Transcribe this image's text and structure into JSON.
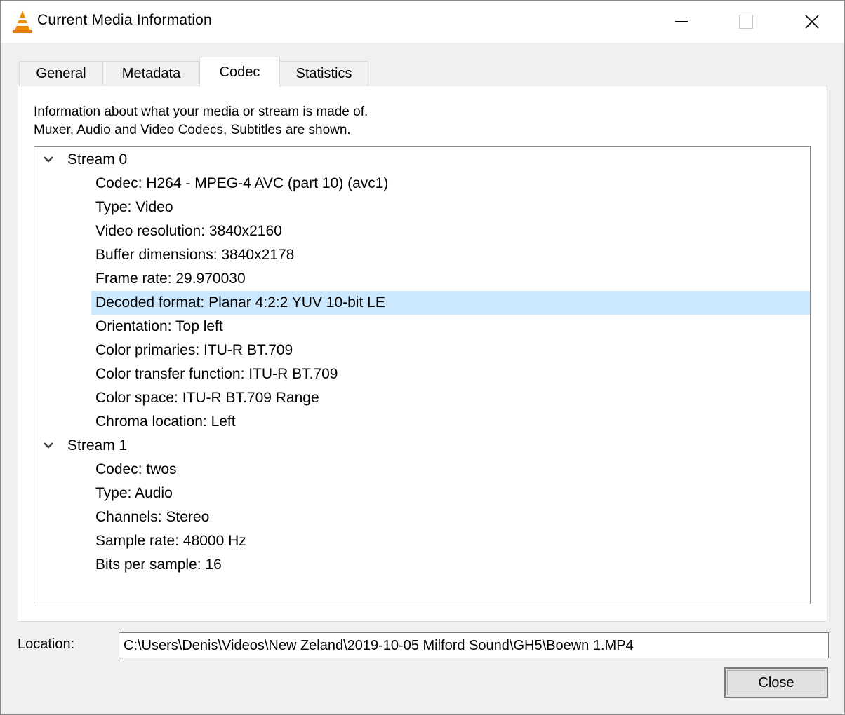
{
  "window": {
    "title": "Current Media Information",
    "app_icon": "vlc-cone-icon"
  },
  "tabs": [
    {
      "label": "General"
    },
    {
      "label": "Metadata"
    },
    {
      "label": "Codec",
      "active": true
    },
    {
      "label": "Statistics"
    }
  ],
  "codec_panel": {
    "description_line1": "Information about what your media or stream is made of.",
    "description_line2": "Muxer, Audio and Video Codecs, Subtitles are shown.",
    "streams": [
      {
        "label": "Stream 0",
        "expanded": true,
        "properties": [
          "Codec: H264 - MPEG-4 AVC (part 10) (avc1)",
          "Type: Video",
          "Video resolution: 3840x2160",
          "Buffer dimensions: 3840x2178",
          "Frame rate: 29.970030",
          "Decoded format: Planar 4:2:2 YUV 10-bit LE",
          "Orientation: Top left",
          "Color primaries: ITU-R BT.709",
          "Color transfer function: ITU-R BT.709",
          "Color space: ITU-R BT.709 Range",
          "Chroma location: Left"
        ],
        "selected_property": "Decoded format: Planar 4:2:2 YUV 10-bit LE"
      },
      {
        "label": "Stream 1",
        "expanded": true,
        "properties": [
          "Codec: twos",
          "Type: Audio",
          "Channels: Stereo",
          "Sample rate: 48000 Hz",
          "Bits per sample: 16"
        ]
      }
    ]
  },
  "location": {
    "label": "Location:",
    "value": "C:\\Users\\Denis\\Videos\\New Zeland\\2019-10-05 Milford Sound\\GH5\\Boewn 1.MP4"
  },
  "buttons": {
    "close_label": "Close"
  },
  "colors": {
    "selection": "#cce8ff",
    "cone_orange": "#f08a00"
  }
}
